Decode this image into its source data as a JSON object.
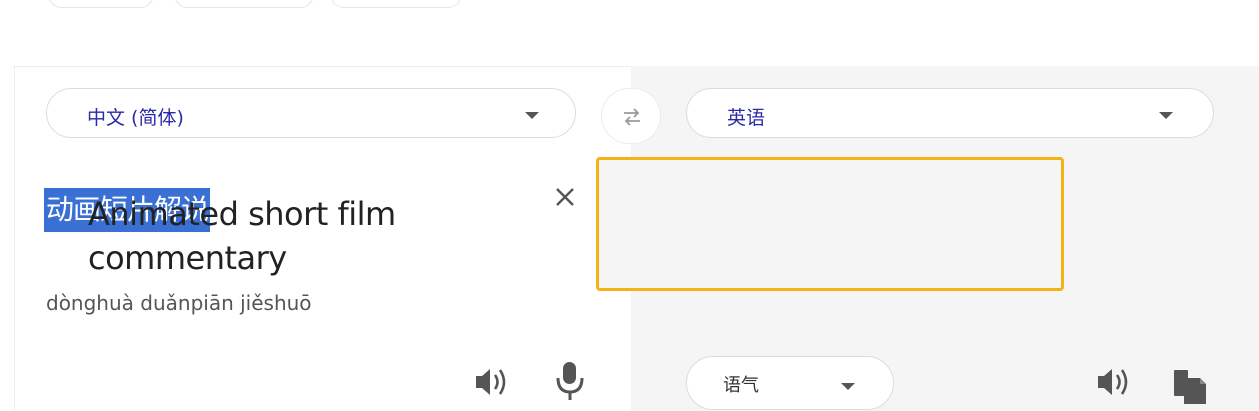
{
  "source_lang": {
    "label": "中文 (简体)",
    "icon": "chevron-down-icon"
  },
  "target_lang": {
    "label": "英语",
    "icon": "chevron-down-icon"
  },
  "swap": {
    "icon": "swap-arrows-icon"
  },
  "source": {
    "text": "动画短片解说",
    "pinyin": "dònghuà duǎnpiān jiěshuō",
    "clear_icon": "close-icon",
    "listen_icon": "speaker-icon",
    "mic_icon": "microphone-icon"
  },
  "translation": {
    "text": "Animated short film commentary",
    "listen_icon": "speaker-icon",
    "copy_icon": "copy-icon"
  },
  "tone": {
    "label": "语气",
    "icon": "chevron-down-icon"
  },
  "colors": {
    "highlight": "#3a6fd4",
    "focus_border": "#f2b415",
    "lang_text": "#2a2aa8",
    "right_panel": "#f5f5f5"
  }
}
